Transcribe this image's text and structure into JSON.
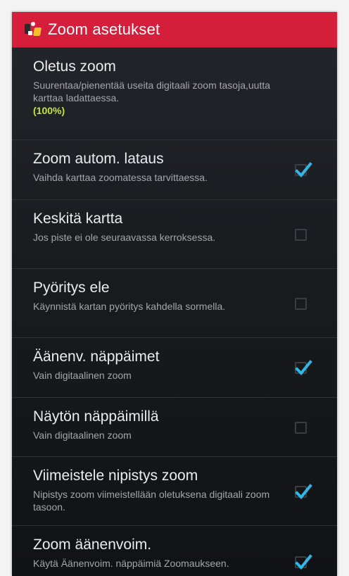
{
  "header": {
    "title": "Zoom asetukset",
    "icon": "app-logo-icon",
    "bg_color": "#d41e3a"
  },
  "items": [
    {
      "title": "Oletus zoom",
      "desc": "Suurentaa/pienentää useita digitaali zoom tasoja,uutta karttaa ladattaessa.",
      "value": "(100%)",
      "has_checkbox": false
    },
    {
      "title": "Zoom autom. lataus",
      "desc": "Vaihda karttaa zoomatessa tarvittaessa.",
      "has_checkbox": true,
      "checked": true
    },
    {
      "title": "Keskitä kartta",
      "desc": "Jos piste ei ole seuraavassa kerroksessa.",
      "has_checkbox": true,
      "checked": false
    },
    {
      "title": "Pyöritys ele",
      "desc": "Käynnistä kartan pyöritys kahdella sormella.",
      "has_checkbox": true,
      "checked": false
    },
    {
      "title": "Äänenv. näppäimet",
      "desc": "Vain digitaalinen zoom",
      "has_checkbox": true,
      "checked": true
    },
    {
      "title": "Näytön näppäimillä",
      "desc": "Vain digitaalinen zoom",
      "has_checkbox": true,
      "checked": false
    },
    {
      "title": "Viimeistele nipistys zoom",
      "desc": "Nipistys zoom viimeistellään oletuksena digitaali zoom tasoon.",
      "has_checkbox": true,
      "checked": true
    },
    {
      "title": "Zoom äänenvoim.",
      "desc": "Käytä Äänenvoim. näppäimiä Zoomaukseen.",
      "has_checkbox": true,
      "checked": true
    }
  ],
  "colors": {
    "accent_check": "#33b5e5",
    "value_text": "#c8e23a"
  }
}
